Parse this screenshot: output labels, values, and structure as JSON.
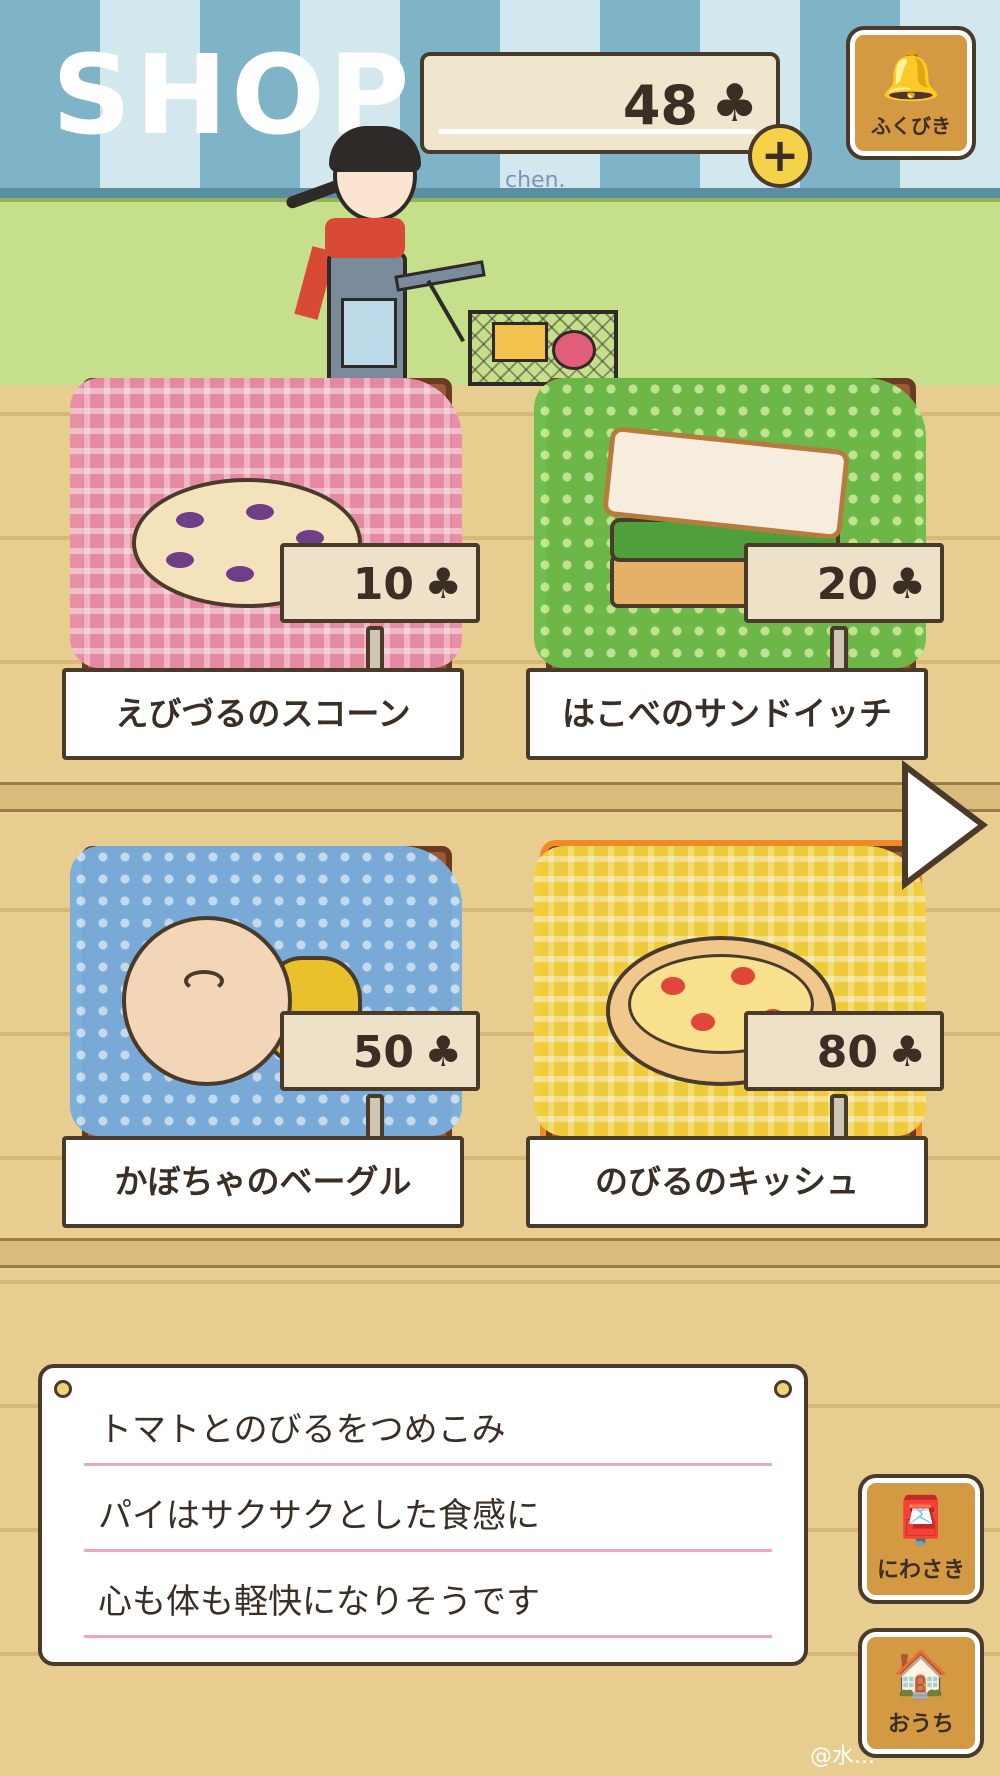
{
  "header": {
    "title": "SHOP",
    "currency_amount": "48",
    "currency_symbol": "♣",
    "plus_label": "+",
    "author": "chen.",
    "lottery_label": "ふくびき",
    "lottery_icon": "bell-icon"
  },
  "items": [
    {
      "name": "えびづるのスコーン",
      "price": "10",
      "cloth_color": "#e98da9",
      "food": "scone",
      "selected": false
    },
    {
      "name": "はこべのサンドイッチ",
      "price": "20",
      "cloth_color": "#6bbd4a",
      "food": "sandwich",
      "selected": false
    },
    {
      "name": "かぼちゃのベーグル",
      "price": "50",
      "cloth_color": "#78aee0",
      "food": "bagel",
      "selected": false
    },
    {
      "name": "のびるのキッシュ",
      "price": "80",
      "cloth_color": "#f3d23c",
      "food": "quiche",
      "selected": true
    }
  ],
  "description": {
    "lines": [
      "トマトとのびるをつめこみ",
      "パイはサクサクとした食感に",
      "心も体も軽快になりそうです"
    ]
  },
  "side_buttons": {
    "garden_label": "にわさき",
    "garden_icon": "mailbox-icon",
    "home_label": "おうち",
    "home_icon": "house-icon"
  },
  "next_arrow_icon": "arrow-right-icon",
  "watermark": "@水..."
}
